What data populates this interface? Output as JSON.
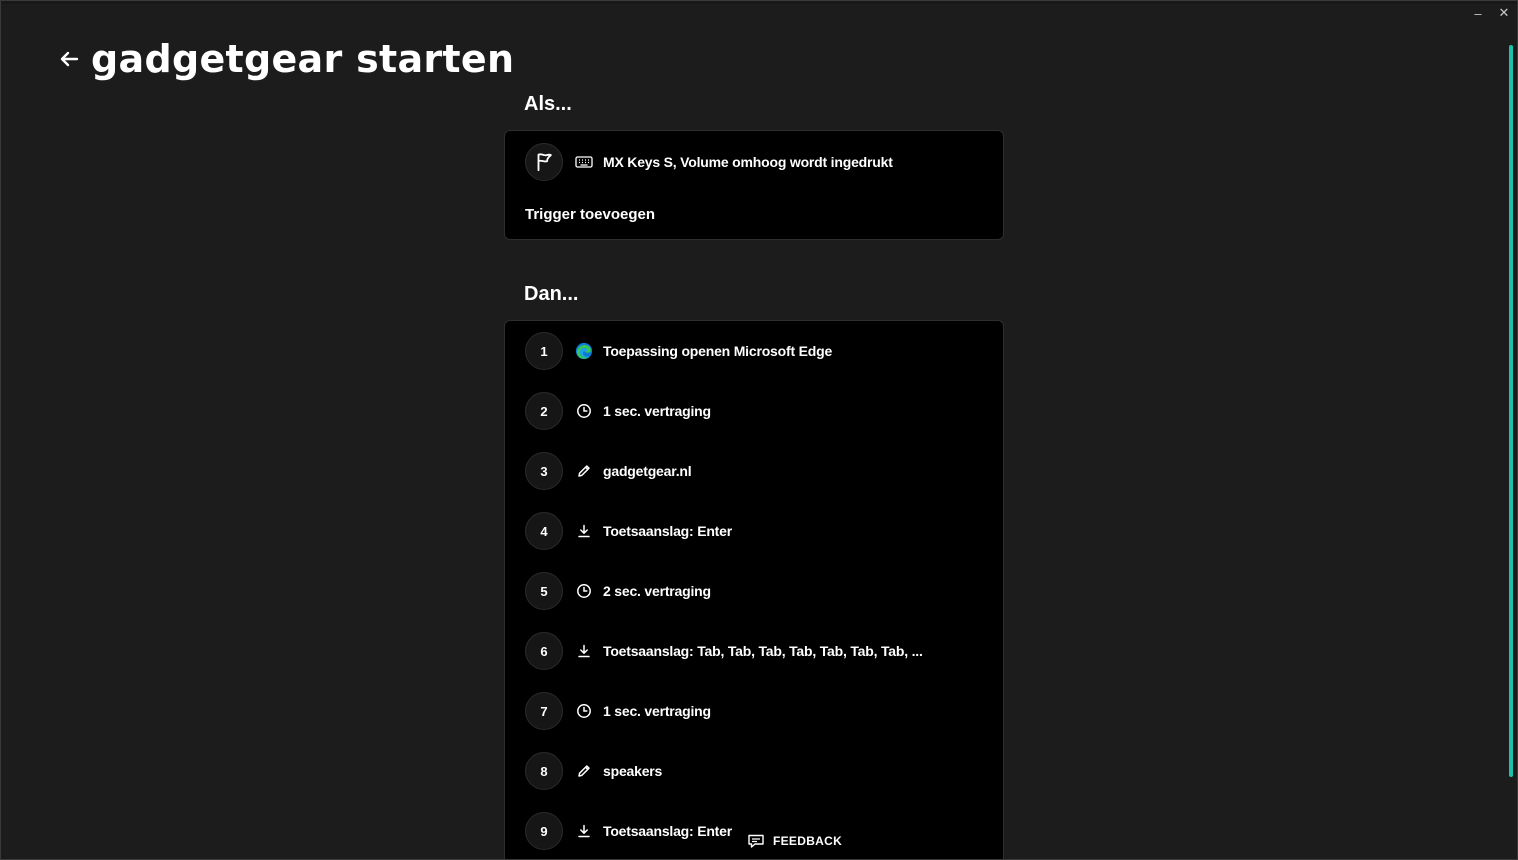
{
  "window": {
    "minimize_label": "–",
    "close_label": "✕"
  },
  "header": {
    "title": "gadgetgear starten"
  },
  "trigger_section": {
    "title": "Als...",
    "trigger_text": "MX Keys S, Volume omhoog wordt ingedrukt",
    "add_trigger_label": "Trigger toevoegen"
  },
  "actions_section": {
    "title": "Dan...",
    "items": [
      {
        "number": "1",
        "icon": "edge-icon",
        "text": "Toepassing openen Microsoft Edge"
      },
      {
        "number": "2",
        "icon": "clock-icon",
        "text": "1 sec. vertraging"
      },
      {
        "number": "3",
        "icon": "pencil-icon",
        "text": "gadgetgear.nl"
      },
      {
        "number": "4",
        "icon": "keystroke-icon",
        "text": "Toetsaanslag: Enter"
      },
      {
        "number": "5",
        "icon": "clock-icon",
        "text": "2 sec. vertraging"
      },
      {
        "number": "6",
        "icon": "keystroke-icon",
        "text": "Toetsaanslag: Tab, Tab, Tab, Tab, Tab, Tab, Tab, ..."
      },
      {
        "number": "7",
        "icon": "clock-icon",
        "text": "1 sec. vertraging"
      },
      {
        "number": "8",
        "icon": "pencil-icon",
        "text": "speakers"
      },
      {
        "number": "9",
        "icon": "keystroke-icon",
        "text": "Toetsaanslag: Enter"
      }
    ]
  },
  "feedback": {
    "label": "FEEDBACK"
  },
  "colors": {
    "background": "#1c1c1c",
    "card": "#000000",
    "accent": "#19c2a8"
  }
}
